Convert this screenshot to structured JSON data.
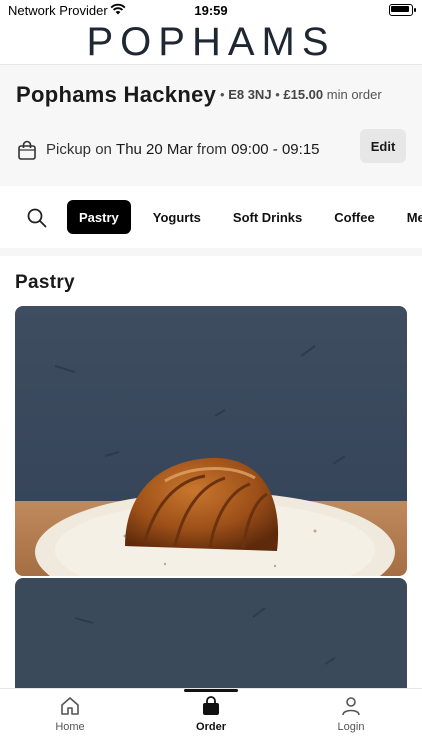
{
  "status_bar": {
    "carrier": "Network Provider",
    "time": "19:59"
  },
  "brand": {
    "logo_text": "POPHAMS"
  },
  "store": {
    "name": "Pophams Hackney",
    "postcode": "E8 3NJ",
    "min_order_amount": "£15.00",
    "min_order_label": "min order",
    "separator": "•",
    "pickup_prefix": "Pickup on",
    "pickup_date": "Thu 20 Mar",
    "pickup_from": "from",
    "pickup_time": "09:00 - 09:15",
    "edit_label": "Edit"
  },
  "categories": {
    "items": [
      "Pastry",
      "Yogurts",
      "Soft Drinks",
      "Coffee",
      "Me"
    ],
    "active": "Pastry"
  },
  "menu": {
    "section_title": "Pastry"
  },
  "tab_bar": {
    "items": [
      {
        "label": "Home",
        "icon": "home-icon"
      },
      {
        "label": "Order",
        "icon": "shopping-bag-icon"
      },
      {
        "label": "Login",
        "icon": "user-icon"
      }
    ],
    "active": "Order"
  },
  "colors": {
    "brand_text": "#1f2733",
    "active_tab_bg": "#000000",
    "photo_wall": "#3c4b5c",
    "photo_table": "#b07a4e"
  }
}
